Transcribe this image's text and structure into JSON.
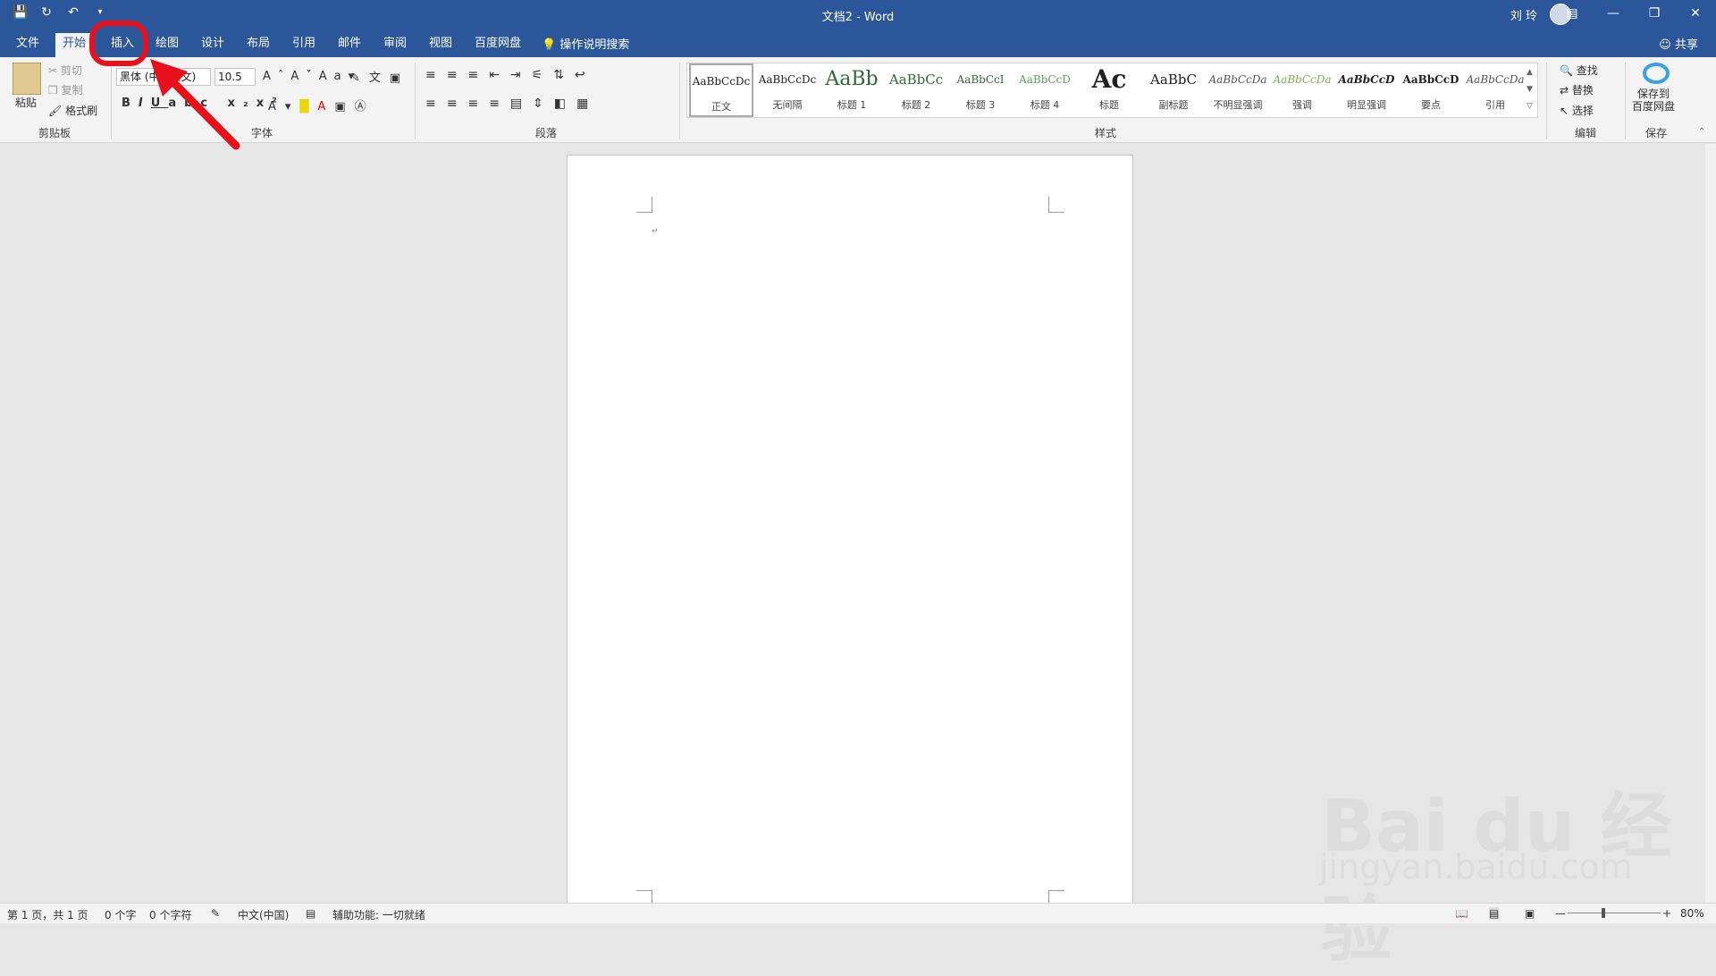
{
  "window": {
    "doc_title": "文档2 - Word",
    "user": "刘 玲"
  },
  "tabs": [
    "文件",
    "开始",
    "插入",
    "绘图",
    "设计",
    "布局",
    "引用",
    "邮件",
    "审阅",
    "视图",
    "百度网盘"
  ],
  "tellme": "操作说明搜索",
  "share": "共享",
  "clipboard": {
    "paste": "粘贴",
    "cut": "剪切",
    "copy": "复制",
    "format_painter": "格式刷",
    "label": "剪贴板"
  },
  "font": {
    "name": "黑体 (中文正文)",
    "size": "10.5",
    "label": "字体"
  },
  "paragraph": {
    "label": "段落"
  },
  "styles": {
    "label": "样式",
    "items": [
      {
        "preview": "AaBbCcDc",
        "name": "正文"
      },
      {
        "preview": "AaBbCcDc",
        "name": "无间隔"
      },
      {
        "preview": "AaBb",
        "name": "标题 1"
      },
      {
        "preview": "AaBbCc",
        "name": "标题 2"
      },
      {
        "preview": "AaBbCcI",
        "name": "标题 3"
      },
      {
        "preview": "AaBbCcD",
        "name": "标题 4"
      },
      {
        "preview": "Ac",
        "name": "标题"
      },
      {
        "preview": "AaBbC",
        "name": "副标题"
      },
      {
        "preview": "AaBbCcDa",
        "name": "不明显强调"
      },
      {
        "preview": "AaBbCcDa",
        "name": "强调"
      },
      {
        "preview": "AaBbCcD",
        "name": "明显强调"
      },
      {
        "preview": "AaBbCcD",
        "name": "要点"
      },
      {
        "preview": "AaBbCcDa",
        "name": "引用"
      }
    ]
  },
  "editing": {
    "find": "查找",
    "replace": "替换",
    "select": "选择",
    "label": "编辑"
  },
  "save": {
    "btn": "保存到\n百度网盘",
    "label": "保存"
  },
  "status": {
    "page": "第 1 页，共 1 页",
    "words": "0 个字",
    "chars": "0 个字符",
    "lang": "中文(中国)",
    "access": "辅助功能: 一切就绪",
    "zoom": "80%"
  },
  "watermark": {
    "logo": "Bai du 经验",
    "url": "jingyan.baidu.com"
  },
  "colors": {
    "brand": "#2b579a",
    "annotation": "#e8101a"
  }
}
